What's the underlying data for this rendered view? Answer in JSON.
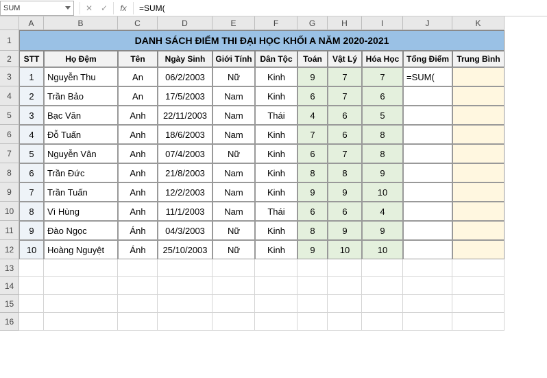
{
  "name_box": "SUM",
  "formula_input": "=SUM(",
  "active_cell_display": "=SUM(",
  "columns": [
    "A",
    "B",
    "C",
    "D",
    "E",
    "F",
    "G",
    "H",
    "I",
    "J",
    "K"
  ],
  "title": "DANH SÁCH ĐIỂM THI ĐẠI HỌC KHỐI A NĂM 2020-2021",
  "headers": {
    "A": "STT",
    "B": "Họ Đệm",
    "C": "Tên",
    "D": "Ngày Sinh",
    "E": "Giới Tính",
    "F": "Dân Tộc",
    "G": "Toán",
    "H": "Vật Lý",
    "I": "Hóa Học",
    "J": "Tổng Điểm",
    "K": "Trung Bình"
  },
  "rows": [
    {
      "A": "1",
      "B": "Nguyễn Thu",
      "C": "An",
      "D": "06/2/2003",
      "E": "Nữ",
      "F": "Kinh",
      "G": "9",
      "H": "7",
      "I": "7",
      "J": "=SUM(",
      "K": ""
    },
    {
      "A": "2",
      "B": "Trần Bảo",
      "C": "An",
      "D": "17/5/2003",
      "E": "Nam",
      "F": "Kinh",
      "G": "6",
      "H": "7",
      "I": "6",
      "J": "",
      "K": ""
    },
    {
      "A": "3",
      "B": "Bạc Văn",
      "C": "Anh",
      "D": "22/11/2003",
      "E": "Nam",
      "F": "Thái",
      "G": "4",
      "H": "6",
      "I": "5",
      "J": "",
      "K": ""
    },
    {
      "A": "4",
      "B": "Đỗ Tuấn",
      "C": "Anh",
      "D": "18/6/2003",
      "E": "Nam",
      "F": "Kinh",
      "G": "7",
      "H": "6",
      "I": "8",
      "J": "",
      "K": ""
    },
    {
      "A": "5",
      "B": "Nguyễn Vân",
      "C": "Anh",
      "D": "07/4/2003",
      "E": "Nữ",
      "F": "Kinh",
      "G": "6",
      "H": "7",
      "I": "8",
      "J": "",
      "K": ""
    },
    {
      "A": "6",
      "B": "Trần Đức",
      "C": "Anh",
      "D": "21/8/2003",
      "E": "Nam",
      "F": "Kinh",
      "G": "8",
      "H": "8",
      "I": "9",
      "J": "",
      "K": ""
    },
    {
      "A": "7",
      "B": "Trần Tuấn",
      "C": "Anh",
      "D": "12/2/2003",
      "E": "Nam",
      "F": "Kinh",
      "G": "9",
      "H": "9",
      "I": "10",
      "J": "",
      "K": ""
    },
    {
      "A": "8",
      "B": "Vì Hùng",
      "C": "Anh",
      "D": "11/1/2003",
      "E": "Nam",
      "F": "Thái",
      "G": "6",
      "H": "6",
      "I": "4",
      "J": "",
      "K": ""
    },
    {
      "A": "9",
      "B": "Đào Ngọc",
      "C": "Ánh",
      "D": "04/3/2003",
      "E": "Nữ",
      "F": "Kinh",
      "G": "8",
      "H": "9",
      "I": "9",
      "J": "",
      "K": ""
    },
    {
      "A": "10",
      "B": "Hoàng Nguyệt",
      "C": "Ánh",
      "D": "25/10/2003",
      "E": "Nữ",
      "F": "Kinh",
      "G": "9",
      "H": "10",
      "I": "10",
      "J": "",
      "K": ""
    }
  ],
  "row_heights": {
    "1": 30,
    "2": 24,
    "data": 28,
    "empty": 26
  },
  "visible_row_labels": [
    "1",
    "2",
    "3",
    "4",
    "5",
    "6",
    "7",
    "8",
    "9",
    "10",
    "11",
    "12",
    "13",
    "14",
    "15",
    "16"
  ]
}
